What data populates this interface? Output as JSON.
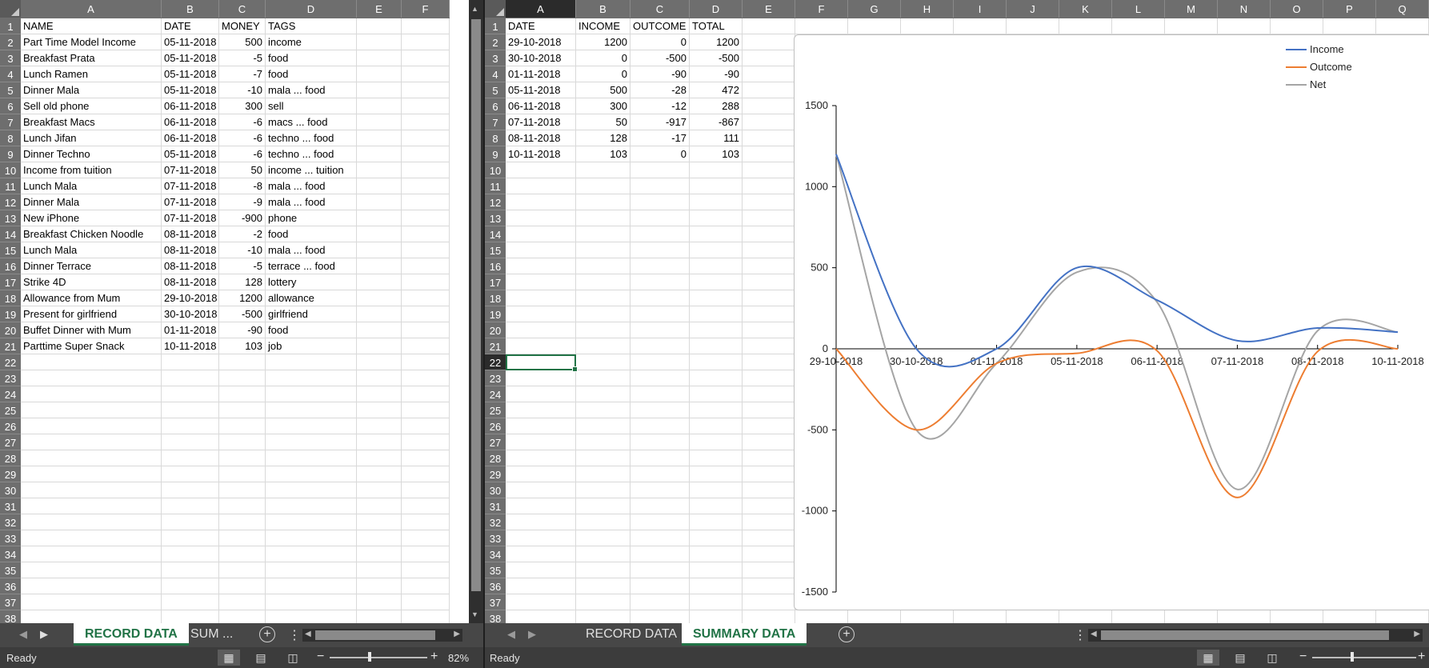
{
  "left": {
    "columns": [
      "A",
      "B",
      "C",
      "D",
      "E",
      "F"
    ],
    "rows_count": 38,
    "headers": [
      "NAME",
      "DATE",
      "MONEY",
      "TAGS"
    ],
    "records": [
      [
        "Part Time Model Income",
        "05-11-2018",
        "500",
        "income"
      ],
      [
        "Breakfast Prata",
        "05-11-2018",
        "-5",
        "food"
      ],
      [
        "Lunch Ramen",
        "05-11-2018",
        "-7",
        "food"
      ],
      [
        "Dinner Mala",
        "05-11-2018",
        "-10",
        "mala  ... food"
      ],
      [
        "Sell old phone",
        "06-11-2018",
        "300",
        "sell"
      ],
      [
        "Breakfast Macs",
        "06-11-2018",
        "-6",
        "macs  ... food"
      ],
      [
        "Lunch Jifan",
        "06-11-2018",
        "-6",
        "techno  ... food"
      ],
      [
        "Dinner Techno",
        "05-11-2018",
        "-6",
        "techno  ... food"
      ],
      [
        "Income from tuition",
        "07-11-2018",
        "50",
        "income  ... tuition"
      ],
      [
        "Lunch Mala",
        "07-11-2018",
        "-8",
        "mala  ... food"
      ],
      [
        "Dinner Mala",
        "07-11-2018",
        "-9",
        "mala  ... food"
      ],
      [
        "New iPhone",
        "07-11-2018",
        "-900",
        "phone"
      ],
      [
        "Breakfast Chicken Noodle",
        "08-11-2018",
        "-2",
        "food"
      ],
      [
        "Lunch Mala",
        "08-11-2018",
        "-10",
        "mala  ... food"
      ],
      [
        "Dinner Terrace",
        "08-11-2018",
        "-5",
        "terrace  ... food"
      ],
      [
        "Strike 4D",
        "08-11-2018",
        "128",
        "lottery"
      ],
      [
        "Allowance from Mum",
        "29-10-2018",
        "1200",
        "allowance"
      ],
      [
        "Present for girlfriend",
        "30-10-2018",
        "-500",
        "girlfriend"
      ],
      [
        "Buffet Dinner with Mum",
        "01-11-2018",
        "-90",
        "food"
      ],
      [
        "Parttime Super Snack",
        "10-11-2018",
        "103",
        "job"
      ]
    ],
    "tabs": [
      "RECORD DATA",
      "SUM ..."
    ],
    "status": "Ready",
    "zoom": "82%"
  },
  "right": {
    "columns": [
      "A",
      "B",
      "C",
      "D",
      "E",
      "F",
      "G",
      "H",
      "I",
      "J",
      "K",
      "L",
      "M",
      "N",
      "O",
      "P",
      "Q"
    ],
    "rows_count": 38,
    "selected_cell": "A22",
    "headers": [
      "DATE",
      "INCOME",
      "OUTCOME",
      "TOTAL"
    ],
    "summary": [
      [
        "29-10-2018",
        "1200",
        "0",
        "1200"
      ],
      [
        "30-10-2018",
        "0",
        "-500",
        "-500"
      ],
      [
        "01-11-2018",
        "0",
        "-90",
        "-90"
      ],
      [
        "05-11-2018",
        "500",
        "-28",
        "472"
      ],
      [
        "06-11-2018",
        "300",
        "-12",
        "288"
      ],
      [
        "07-11-2018",
        "50",
        "-917",
        "-867"
      ],
      [
        "08-11-2018",
        "128",
        "-17",
        "111"
      ],
      [
        "10-11-2018",
        "103",
        "0",
        "103"
      ]
    ],
    "tabs": [
      "RECORD DATA",
      "SUMMARY DATA"
    ],
    "status": "Ready"
  },
  "colors": {
    "accent": "#217346",
    "income": "#4472c4",
    "outcome": "#ed7d31",
    "net": "#a5a5a5"
  },
  "chart_data": {
    "type": "line",
    "smooth": true,
    "categories": [
      "29-10-2018",
      "30-10-2018",
      "01-11-2018",
      "05-11-2018",
      "06-11-2018",
      "07-11-2018",
      "08-11-2018",
      "10-11-2018"
    ],
    "series": [
      {
        "name": "Income",
        "values": [
          1200,
          0,
          0,
          500,
          300,
          50,
          128,
          103
        ]
      },
      {
        "name": "Outcome",
        "values": [
          0,
          -500,
          -90,
          -28,
          -12,
          -917,
          -17,
          0
        ]
      },
      {
        "name": "Net",
        "values": [
          1200,
          -500,
          -90,
          472,
          288,
          -867,
          111,
          103
        ]
      }
    ],
    "ylim": [
      -1500,
      1500
    ],
    "yticks": [
      1500,
      1000,
      500,
      0,
      -500,
      -1000,
      -1500
    ],
    "legend": "top-right",
    "grid": false,
    "title": "",
    "xlabel": "",
    "ylabel": ""
  }
}
